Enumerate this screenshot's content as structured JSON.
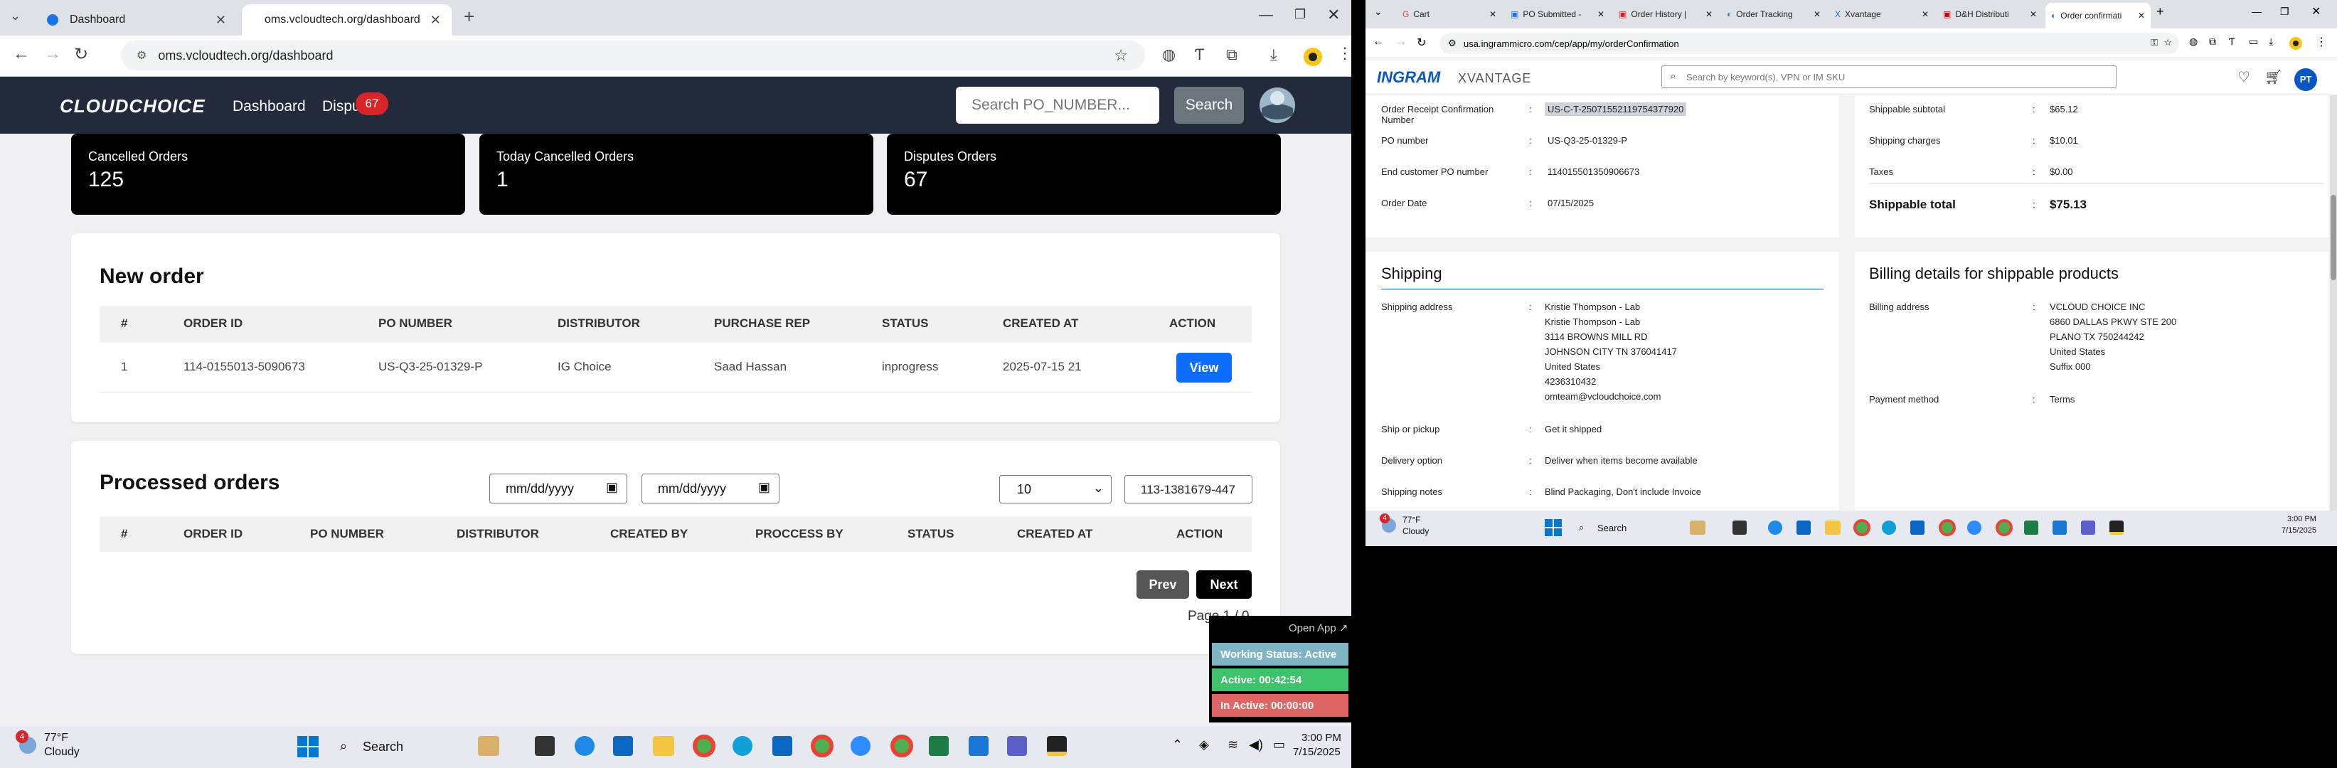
{
  "left": {
    "tabs": [
      {
        "label": "Dashboard",
        "icon": "globe-icon"
      },
      {
        "label": "oms.vcloudtech.org/dashboard",
        "icon": "app-icon"
      }
    ],
    "url": "oms.vcloudtech.org/dashboard",
    "brand": "CLOUDCHOICE",
    "nav": {
      "dashboard": "Dashboard",
      "disputes": "Dispu",
      "badge": "67"
    },
    "search": {
      "placeholder": "Search PO_NUMBER...",
      "button": "Search"
    },
    "stats": [
      {
        "label": "Cancelled Orders",
        "value": "125"
      },
      {
        "label": "Today Cancelled Orders",
        "value": "1"
      },
      {
        "label": "Disputes Orders",
        "value": "67"
      }
    ],
    "new_order": {
      "title": "New order",
      "headers": [
        "#",
        "ORDER ID",
        "PO NUMBER",
        "DISTRIBUTOR",
        "PURCHASE REP",
        "STATUS",
        "CREATED AT",
        "ACTION"
      ],
      "row": {
        "num": "1",
        "order_id": "114-0155013-5090673",
        "po": "US-Q3-25-01329-P",
        "dist": "IG Choice",
        "rep": "Saad Hassan",
        "status": "inprogress",
        "created": "2025-07-15 21",
        "action": "View"
      }
    },
    "processed": {
      "title": "Processed orders",
      "date_placeholder": "mm/dd/yyyy",
      "page_size": "10",
      "search_value": "113-1381679-447",
      "headers": [
        "#",
        "ORDER ID",
        "PO NUMBER",
        "DISTRIBUTOR",
        "CREATED BY",
        "PROCCESS BY",
        "STATUS",
        "CREATED AT",
        "ACTION"
      ],
      "prev": "Prev",
      "next": "Next",
      "page": "Page 1 / 0"
    },
    "widget": {
      "open": "Open App ↗",
      "working": "Working Status: Active",
      "active": "Active: 00:42:54",
      "inactive": "In Active: 00:00:00"
    },
    "taskbar": {
      "temp": "77°F",
      "weather": "Cloudy",
      "search": "Search",
      "time": "3:00 PM",
      "date": "7/15/2025",
      "weather_badge": "4"
    }
  },
  "right": {
    "tabs": [
      "Cart",
      "PO Submitted -",
      "Order History |",
      "Order Tracking",
      "Xvantage",
      "D&H Distributi",
      "Order confirmati"
    ],
    "url": "usa.ingrammicro.com/cep/app/my/orderConfirmation",
    "brand_left": "INGRAM",
    "brand_right": "XVANTAGE",
    "search_placeholder": "Search by keyword(s), VPN or IM SKU",
    "avatar": "PT",
    "order": [
      {
        "label": "Order Receipt Confirmation Number",
        "value": "US-C-T-25071552119754377920"
      },
      {
        "label": "PO number",
        "value": "US-Q3-25-01329-P"
      },
      {
        "label": "End customer PO number",
        "value": "114015501350906673"
      },
      {
        "label": "Order Date",
        "value": "07/15/2025"
      }
    ],
    "totals": [
      {
        "label": "Shippable subtotal",
        "value": "$65.12"
      },
      {
        "label": "Shipping charges",
        "value": "$10.01"
      },
      {
        "label": "Taxes",
        "value": "$0.00"
      },
      {
        "label": "Shippable total",
        "value": "$75.13"
      }
    ],
    "shipping": {
      "title": "Shipping",
      "address_label": "Shipping address",
      "address": [
        "Kristie Thompson - Lab",
        "Kristie Thompson - Lab",
        "3114 BROWNS MILL RD",
        "JOHNSON CITY TN 376041417",
        "United States",
        "4236310432",
        "omteam@vcloudchoice.com"
      ],
      "ship_label": "Ship or pickup",
      "ship_value": "Get it shipped",
      "delivery_label": "Delivery option",
      "delivery_value": "Deliver when items become available",
      "notes_label": "Shipping notes",
      "notes_value": "Blind Packaging, Don't include Invoice"
    },
    "billing": {
      "title": "Billing details for shippable products",
      "address_label": "Billing address",
      "address": [
        "VCLOUD CHOICE INC",
        "6860 DALLAS PKWY STE 200",
        "PLANO TX 750244242",
        "United States",
        "Suffix 000"
      ],
      "payment_label": "Payment method",
      "payment_value": "Terms"
    },
    "taskbar": {
      "temp": "77°F",
      "weather": "Cloudy",
      "search": "Search",
      "time": "3:00 PM",
      "date": "7/15/2025",
      "weather_badge": "4"
    }
  }
}
